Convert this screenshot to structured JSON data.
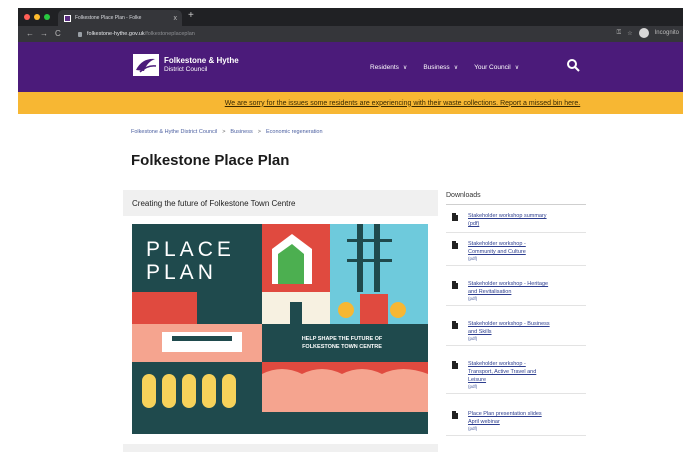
{
  "browser": {
    "tab_title": "Folkestone Place Plan - Folke",
    "tab_close": "x",
    "new_tab": "+",
    "back": "←",
    "forward": "→",
    "reload": "C",
    "url_host": "folkestone-hythe.gov.uk",
    "url_path": "/folkestoneplaceplan",
    "incognito_label": "Incognito"
  },
  "site": {
    "brand_line1": "Folkestone & Hythe",
    "brand_line2": "District Council",
    "nav": [
      {
        "label": "Residents"
      },
      {
        "label": "Business"
      },
      {
        "label": "Your Council"
      }
    ],
    "alert": "We are sorry for the issues some residents are experiencing with their waste collections. Report a missed bin here."
  },
  "page": {
    "breadcrumb": [
      "Folkestone & Hythe District Council",
      "Business",
      "Economic regeneration"
    ],
    "breadcrumb_sep": ">",
    "title": "Folkestone Place Plan",
    "section_title": "Creating the future of Folkestone Town Centre",
    "poster": {
      "line1": "PLACE",
      "line2": "PLAN",
      "tagline1": "HELP SHAPE THE FUTURE OF",
      "tagline2": "FOLKESTONE TOWN CENTRE"
    }
  },
  "downloads": {
    "title": "Downloads",
    "items": [
      {
        "line1": "Stakeholder workshop summary",
        "line2": "(pdf)",
        "meta": ""
      },
      {
        "line1": "Stakeholder workshop -",
        "line2": "Community and Culture",
        "meta": "(pdf)"
      },
      {
        "line1": "Stakeholder workshop - Heritage",
        "line2": "and Revitalisation",
        "meta": "(pdf)"
      },
      {
        "line1": "Stakeholder workshop - Business",
        "line2": "and Skills",
        "meta": "(pdf)"
      },
      {
        "line1": "Stakeholder workshop -",
        "line2": "Transport, Active Travel and",
        "line3": "Leisure",
        "meta": "(pdf)"
      },
      {
        "line1": "Place Plan presentation slides",
        "line2": "April webinar",
        "meta": "(pdf)"
      }
    ]
  },
  "colors": {
    "header": "#4b1b7a",
    "alert": "#f7b733",
    "link": "#2d3e8f"
  }
}
